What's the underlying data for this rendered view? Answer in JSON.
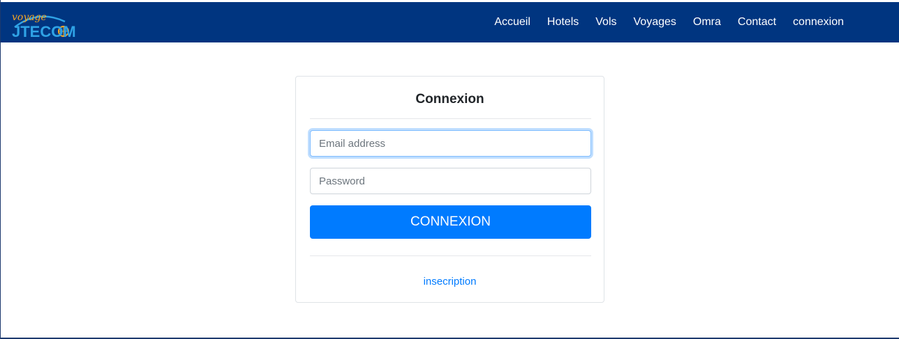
{
  "logo": {
    "script_text": "voyage",
    "brand_text": "JTECOM"
  },
  "nav": {
    "items": [
      {
        "label": "Accueil"
      },
      {
        "label": "Hotels"
      },
      {
        "label": "Vols"
      },
      {
        "label": "Voyages"
      },
      {
        "label": "Omra"
      },
      {
        "label": "Contact"
      },
      {
        "label": "connexion"
      }
    ]
  },
  "login": {
    "title": "Connexion",
    "email": {
      "placeholder": "Email address",
      "value": ""
    },
    "password": {
      "placeholder": "Password",
      "value": ""
    },
    "submit_label": "CONNEXION",
    "signup_link": "insecription"
  },
  "colors": {
    "navbar": "#003580",
    "primary_button": "#007bff",
    "link": "#007bff",
    "logo_blue": "#2fa3e6",
    "logo_orange": "#f5a623"
  }
}
